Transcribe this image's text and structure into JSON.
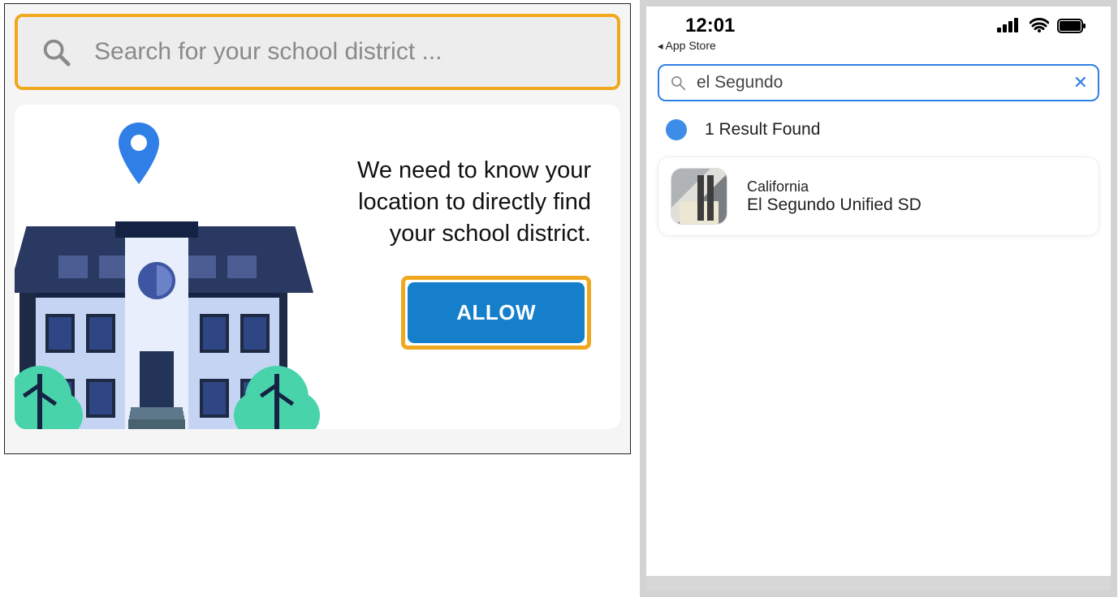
{
  "left": {
    "search_placeholder": "Search for your school district ...",
    "location_message": "We need to know your location to directly find your school district.",
    "allow_label": "ALLOW"
  },
  "phone": {
    "status_time": "12:01",
    "back_crumb": "App Store",
    "search_value": "el Segundo",
    "results_header": "1 Result Found",
    "result": {
      "state": "California",
      "name": "El Segundo Unified SD"
    }
  }
}
